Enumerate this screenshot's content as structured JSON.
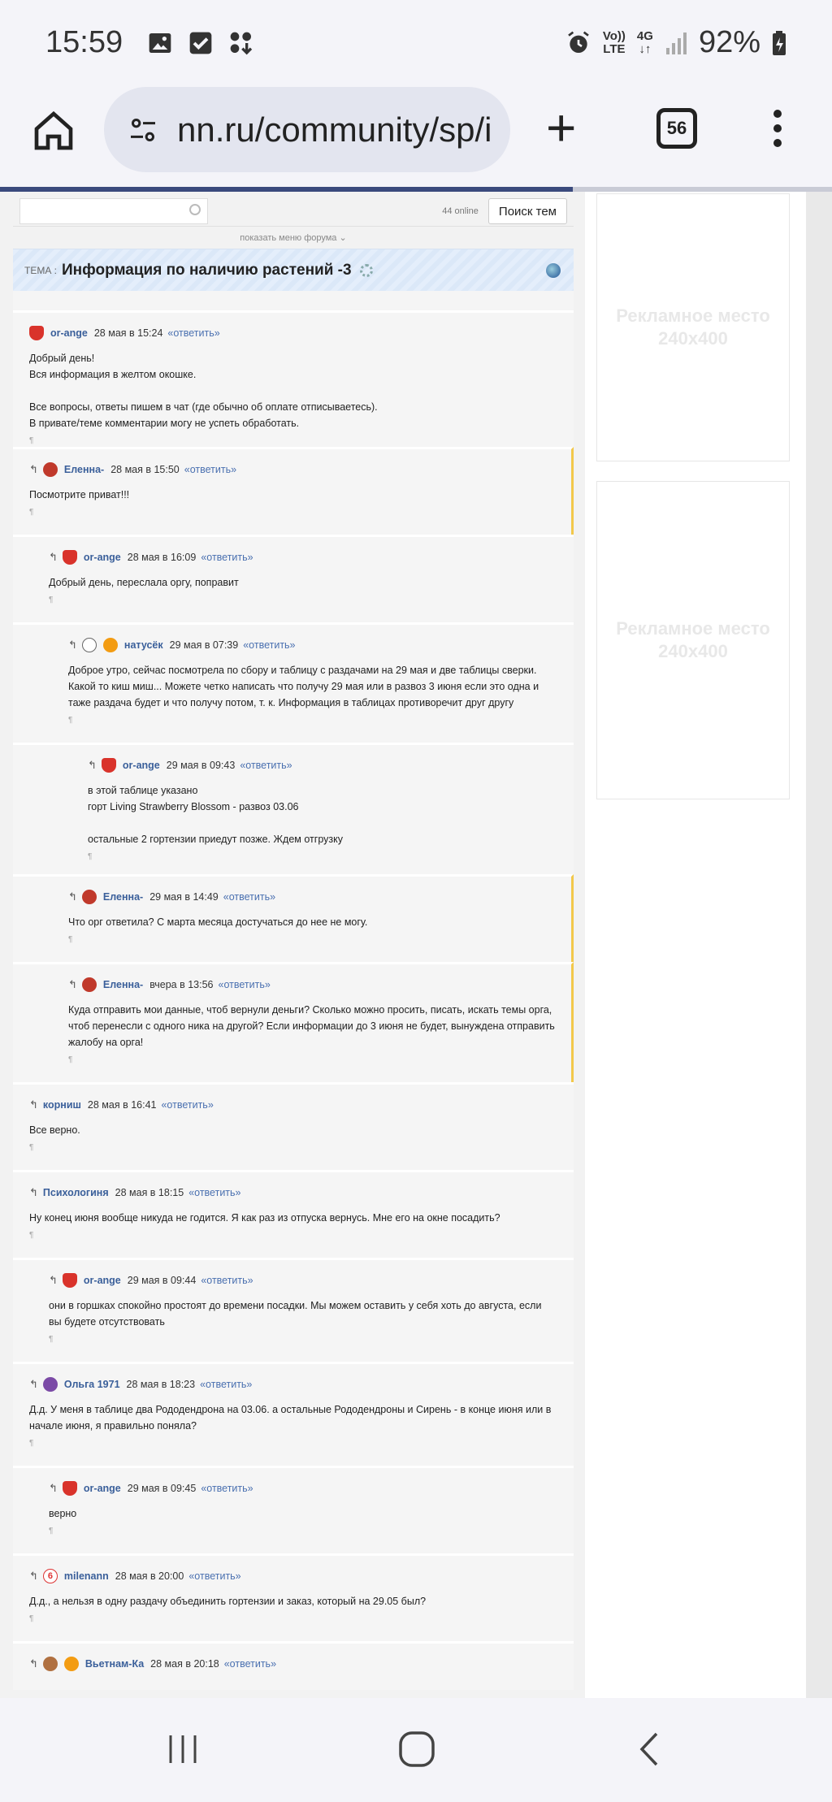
{
  "status": {
    "time": "15:59",
    "battery": "92%",
    "net_top": "Vo))",
    "net_bottom": "LTE",
    "g_top": "4G",
    "g_bottom": "↓↑"
  },
  "browser": {
    "url": "nn.ru/community/sp/i",
    "tab_count": "56"
  },
  "forum": {
    "online": "44 online",
    "search_button": "Поиск тем",
    "show_menu": "показать меню форума",
    "topic_label": "ТЕМА :",
    "topic_title": "Информация по наличию растений -3"
  },
  "ads": [
    {
      "line1": "Рекламное место",
      "line2": "240x400"
    },
    {
      "line1": "Рекламное место",
      "line2": "240x400"
    }
  ],
  "reply_label": "«ответить»",
  "pilcrow": "¶",
  "posts": [
    {
      "nick": "or-ange",
      "date": "28 мая в 15:24",
      "lines": [
        "Добрый день!",
        "Вся информация в желтом окошке.",
        "",
        "Все вопросы, ответы пишем в чат (где обычно об оплате отписываетесь).",
        "В привате/теме комментарии могу не успеть обработать."
      ]
    },
    {
      "nick": "Еленна-",
      "date": "28 мая в 15:50",
      "lines": [
        "Посмотрите приват!!!"
      ]
    },
    {
      "nick": "or-ange",
      "date": "28 мая в 16:09",
      "lines": [
        "Добрый день, переслала оргу, поправит"
      ]
    },
    {
      "nick": "натусёк",
      "date": "29 мая в 07:39",
      "lines": [
        "Доброе утро, сейчас посмотрела по сбору и таблицу с раздачами на 29 мая и две таблицы сверки.",
        "Какой то киш миш... Можете четко написать что получу 29 мая или в развоз 3 июня если это одна и",
        "таже раздача будет и что получу потом, т. к. Информация в таблицах противоречит друг другу"
      ]
    },
    {
      "nick": "or-ange",
      "date": "29 мая в 09:43",
      "lines": [
        "в этой таблице указано",
        "горт Living Strawberry Blossom - развоз 03.06",
        "",
        "остальные 2 гортензии приедут позже. Ждем отгрузку"
      ]
    },
    {
      "nick": "Еленна-",
      "date": "29 мая в 14:49",
      "lines": [
        "Что орг ответила? С марта месяца достучаться до нее не могу."
      ]
    },
    {
      "nick": "Еленна-",
      "date": "вчера в 13:56",
      "lines": [
        "Куда отправить мои данные, чтоб вернули деньги? Сколько можно просить, писать, искать темы орга,",
        "чтоб перенесли с одного ника на другой? Если информации до 3 июня не будет, вынуждена отправить",
        "жалобу на орга!"
      ]
    },
    {
      "nick": "корниш",
      "date": "28 мая в 16:41",
      "lines": [
        "Все верно."
      ]
    },
    {
      "nick": "Психологиня",
      "date": "28 мая в 18:15",
      "lines": [
        "Ну конец июня вообще никуда не годится. Я как раз из отпуска вернусь. Мне его на окне посадить?"
      ]
    },
    {
      "nick": "or-ange",
      "date": "29 мая в 09:44",
      "lines": [
        "они в горшках спокойно простоят до времени посадки. Мы можем оставить у себя хоть до августа, если",
        "вы будете отсутствовать"
      ]
    },
    {
      "nick": "Ольга 1971",
      "date": "28 мая в 18:23",
      "lines": [
        "Д.д. У меня в таблице два Рододендрона на 03.06. а остальные Рододендроны и Сирень - в конце июня или в",
        "начале июня, я правильно поняла?"
      ]
    },
    {
      "nick": "or-ange",
      "date": "29 мая в 09:45",
      "lines": [
        "верно"
      ]
    },
    {
      "nick": "milenann",
      "date": "28 мая в 20:00",
      "lines": [
        "Д.д., а нельзя в одну раздачу объединить гортензии и заказ, который на 29.05 был?"
      ]
    },
    {
      "nick": "Вьетнам-Ка",
      "date": "28 мая в 20:18",
      "lines": []
    }
  ]
}
